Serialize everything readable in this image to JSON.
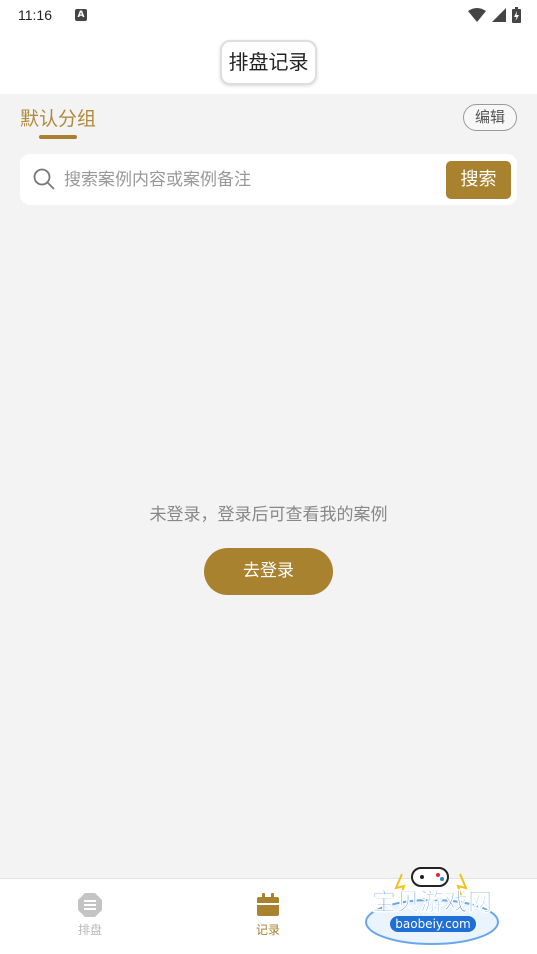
{
  "status_bar": {
    "time": "11:16",
    "notification_letter": "A"
  },
  "header": {
    "title": "排盘记录"
  },
  "group": {
    "tab_label": "默认分组",
    "edit_label": "编辑"
  },
  "search": {
    "placeholder": "搜索案例内容或案例备注",
    "value": "",
    "button_label": "搜索"
  },
  "empty_state": {
    "message": "未登录，登录后可查看我的案例",
    "login_label": "去登录"
  },
  "bottom_nav": {
    "items": [
      {
        "label": "排盘",
        "icon": "menu-circle-icon",
        "active": false
      },
      {
        "label": "记录",
        "icon": "calendar-icon",
        "active": true
      }
    ]
  },
  "watermark": {
    "title": "宝贝游戏网",
    "url": "baobeiy.com"
  },
  "colors": {
    "accent": "#a8822f",
    "background": "#f3f3f3"
  }
}
